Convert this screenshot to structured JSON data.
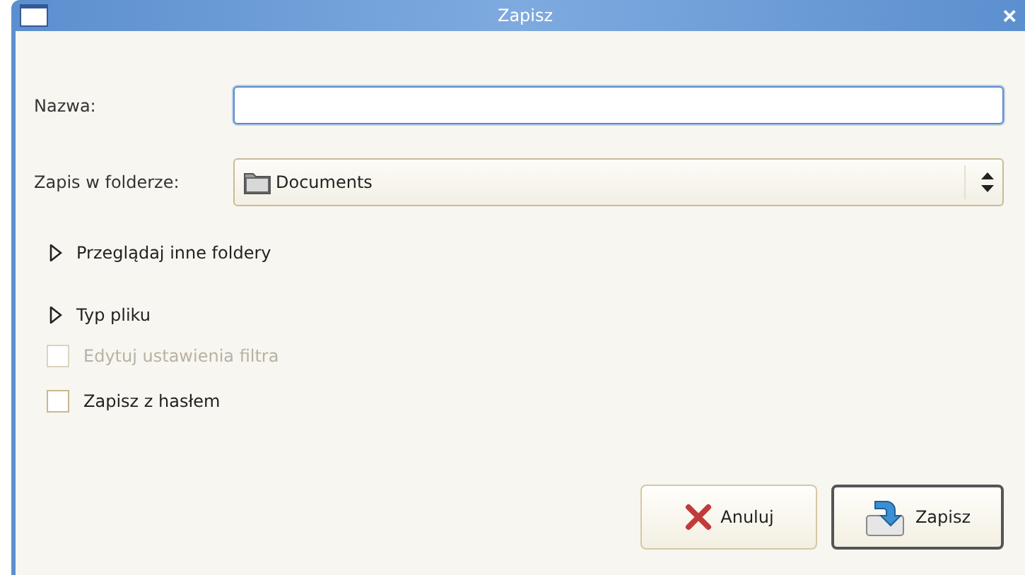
{
  "window": {
    "title": "Zapisz",
    "close": "×"
  },
  "name_field": {
    "label": "Nazwa:"
  },
  "folder": {
    "label": "Zapis w folderze:",
    "value": "Documents"
  },
  "expanders": [
    {
      "label": "Przeglądaj inne foldery",
      "expanded": false
    },
    {
      "label": "Typ pliku",
      "expanded": false
    }
  ],
  "options": [
    {
      "label": "Edytuj ustawienia filtra",
      "checked": false,
      "disabled": true
    },
    {
      "label": "Zapisz z hasłem",
      "checked": false,
      "disabled": false
    }
  ],
  "buttons": [
    {
      "kind": "cancel",
      "label": "Anuluj"
    },
    {
      "kind": "save",
      "label": "Zapisz"
    }
  ]
}
